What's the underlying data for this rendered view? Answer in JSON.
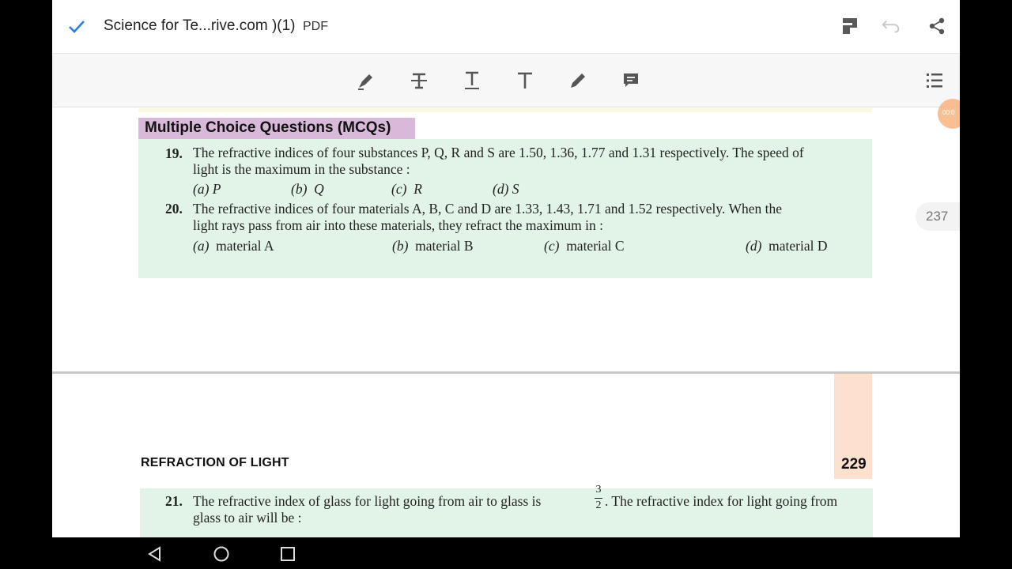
{
  "titlebar": {
    "title": "Science for Te...rive.com )(1)",
    "doc_type": "PDF",
    "icons": [
      "check-icon",
      "bookmark-icon",
      "undo-icon",
      "share-icon"
    ]
  },
  "annotation_toolbar": {
    "tools": [
      "highlight-pen-icon",
      "strikethrough-icon",
      "underline-icon",
      "add-text-icon",
      "draw-pencil-icon",
      "comment-icon",
      "outline-list-icon"
    ]
  },
  "page_a": {
    "section_title": "Multiple Choice Questions (MCQs)",
    "q19": {
      "num": "19.",
      "line1": "The refractive indices of four substances P, Q, R and S are 1.50, 1.36, 1.77 and 1.31 respectively. The speed of",
      "line2": "light is the maximum in the substance :",
      "opts": [
        {
          "label": "(a)",
          "text": "P"
        },
        {
          "label": "(b)",
          "text": "Q"
        },
        {
          "label": "(c)",
          "text": "R"
        },
        {
          "label": "(d)",
          "text": "S"
        }
      ]
    },
    "q20": {
      "num": "20.",
      "line1": "The refractive indices of four materials A, B, C and D are 1.33, 1.43, 1.71 and 1.52 respectively. When the",
      "line2": "light rays pass from air into these materials, they refract the maximum in :",
      "opts": [
        {
          "label": "(a)",
          "text": "material A"
        },
        {
          "label": "(b)",
          "text": "material B"
        },
        {
          "label": "(c)",
          "text": "material C"
        },
        {
          "label": "(d)",
          "text": "material D"
        }
      ]
    },
    "page_indicator": "237"
  },
  "page_b": {
    "chapter": "REFRACTION OF LIGHT",
    "page_number": "229",
    "q21": {
      "num": "21.",
      "line1_pre": "The refractive index of glass for light going from air to glass is",
      "frac_num": "3",
      "frac_den": "2",
      "line1_post": ". The refractive index for light going from",
      "line2": "glass to air will be :"
    }
  },
  "float_badge": "00:0",
  "nav": {
    "icons": [
      "back-icon",
      "home-icon",
      "recents-icon"
    ]
  },
  "colors": {
    "accent": "#2a7de1",
    "mcq_header": "#d9b9d9",
    "question_box": "#e2f3e8",
    "page_tab": "#fde0cd"
  }
}
